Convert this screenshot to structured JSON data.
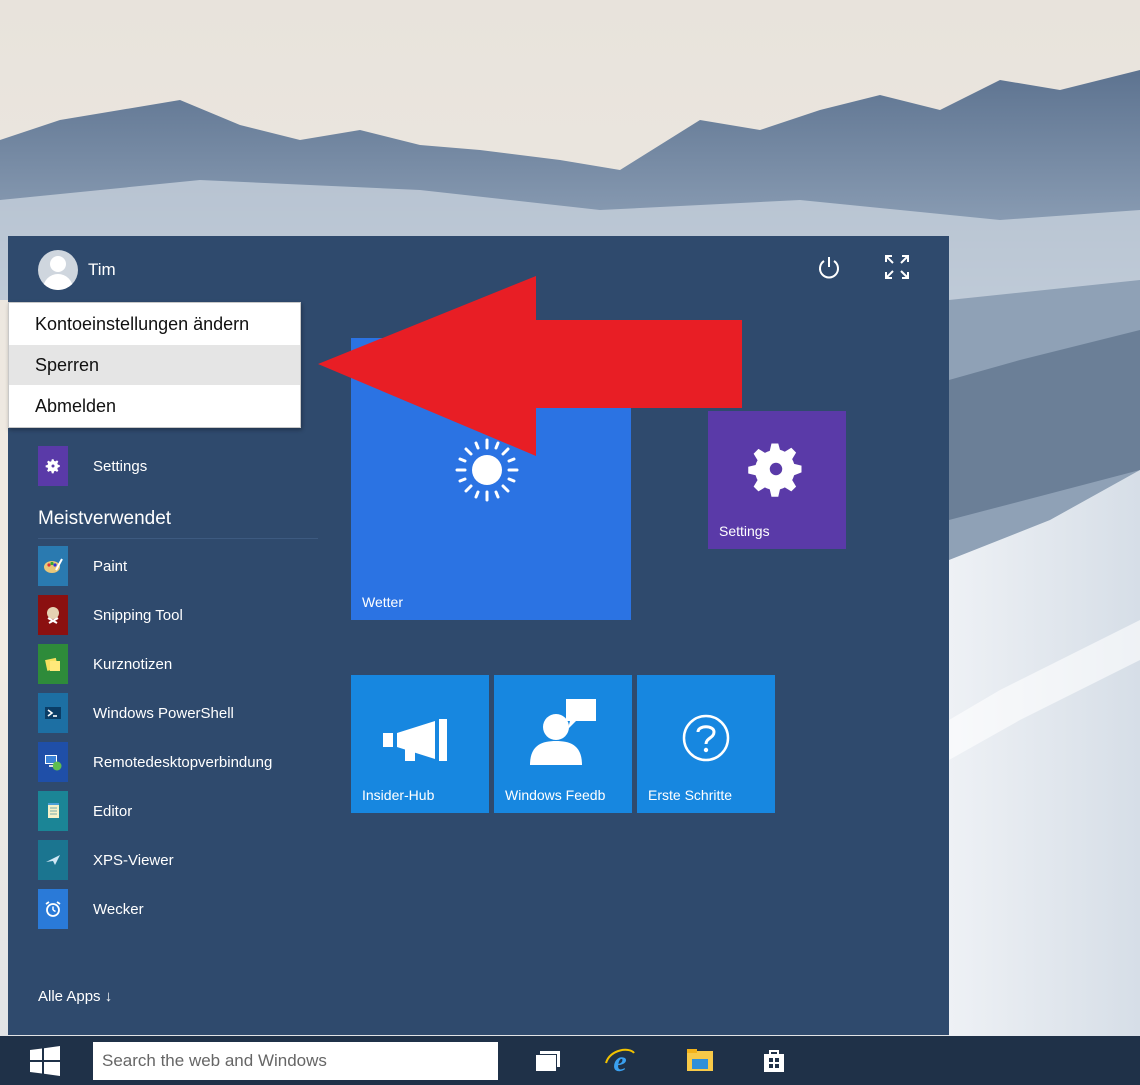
{
  "user": {
    "name": "Tim"
  },
  "context_menu": {
    "items": [
      {
        "label": "Kontoeinstellungen ändern"
      },
      {
        "label": "Sperren"
      },
      {
        "label": "Abmelden"
      }
    ]
  },
  "pinned": {
    "settings_label": "Settings"
  },
  "most_used": {
    "heading": "Meistverwendet",
    "items": [
      {
        "label": "Paint",
        "icon": "paint-icon",
        "color": "#2a7ab0"
      },
      {
        "label": "Snipping Tool",
        "icon": "snipping-tool-icon",
        "color": "#8b1010"
      },
      {
        "label": "Kurznotizen",
        "icon": "sticky-notes-icon",
        "color": "#2e8b3a"
      },
      {
        "label": "Windows PowerShell",
        "icon": "powershell-icon",
        "color": "#1d6fa3"
      },
      {
        "label": "Remotedesktopverbindung",
        "icon": "remote-desktop-icon",
        "color": "#1f4fa8"
      },
      {
        "label": "Editor",
        "icon": "notepad-icon",
        "color": "#1b8596"
      },
      {
        "label": "XPS-Viewer",
        "icon": "xps-viewer-icon",
        "color": "#1b7590"
      },
      {
        "label": "Wecker",
        "icon": "alarm-clock-icon",
        "color": "#2a7ad8"
      }
    ]
  },
  "all_apps": {
    "label": "Alle Apps ↓"
  },
  "tiles": {
    "wetter": {
      "label": "Wetter",
      "icon": "weather-sun-icon",
      "color": "#2b73e3"
    },
    "settings": {
      "label": "Settings",
      "icon": "gear-icon",
      "color": "#5a3aa8"
    },
    "insider_hub": {
      "label": "Insider-Hub",
      "icon": "megaphone-icon",
      "color": "#1787e0"
    },
    "windows_feedback": {
      "label": "Windows Feedb",
      "icon": "feedback-icon",
      "color": "#1787e0"
    },
    "erste_schritte": {
      "label": "Erste Schritte",
      "icon": "question-icon",
      "color": "#1787e0"
    }
  },
  "taskbar": {
    "search_placeholder": "Search the web and Windows",
    "icons": [
      "task-view-icon",
      "internet-explorer-icon",
      "file-explorer-icon",
      "store-icon"
    ]
  },
  "colors": {
    "start_bg": "#2f4a6d",
    "taskbar_bg": "#1f3148",
    "arrow": "#e81e25"
  }
}
